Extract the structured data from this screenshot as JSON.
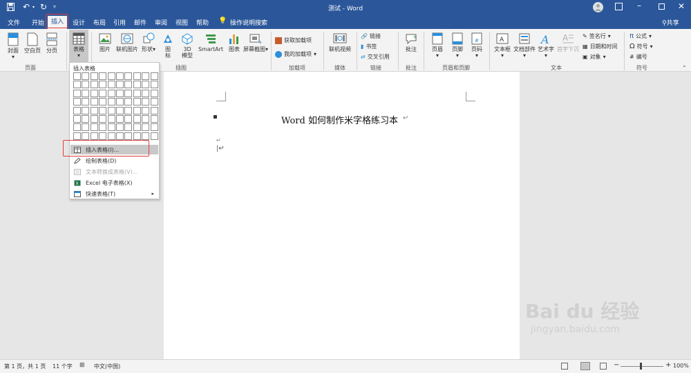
{
  "titlebar": {
    "doc_title": "测试 - Word"
  },
  "tabs": [
    {
      "label": "文件"
    },
    {
      "label": "开始"
    },
    {
      "label": "插入"
    },
    {
      "label": "设计"
    },
    {
      "label": "布局"
    },
    {
      "label": "引用"
    },
    {
      "label": "邮件"
    },
    {
      "label": "审阅"
    },
    {
      "label": "视图"
    },
    {
      "label": "帮助"
    }
  ],
  "tell_me": "操作说明搜索",
  "share": "共享",
  "ribbon": {
    "pages": {
      "cover": "封面",
      "blank": "空白页",
      "break": "分页",
      "group": "页面"
    },
    "tables": {
      "table": "表格"
    },
    "illustrations": {
      "picture": "图片",
      "online_picture": "联机图片",
      "shapes": "形状",
      "icons_line1": "图",
      "icons_line2": "标",
      "model_line1": "3D",
      "model_line2": "模型",
      "smartart": "SmartArt",
      "chart": "图表",
      "screenshot": "屏幕截图",
      "group": "插图"
    },
    "addins": {
      "get": "获取加载项",
      "mine": "我的加载项",
      "group": "加载项"
    },
    "media": {
      "video": "联机视频",
      "group": "媒体"
    },
    "links": {
      "link": "链接",
      "bookmark": "书签",
      "xref": "交叉引用",
      "group": "链接"
    },
    "comments": {
      "comment": "批注",
      "group": "批注"
    },
    "header_footer": {
      "header": "页眉",
      "footer": "页脚",
      "page_number": "页码",
      "group": "页眉和页脚"
    },
    "text": {
      "textbox": "文本框",
      "quickparts": "文档部件",
      "wordart": "艺术字",
      "dropcap": "首字下沉",
      "signature": "签名行",
      "datetime": "日期和时间",
      "object": "对象",
      "group": "文本"
    },
    "symbols": {
      "equation": "公式",
      "symbol": "符号",
      "numbering": "编号",
      "group": "符号"
    }
  },
  "dropdown": {
    "header": "插入表格",
    "items": [
      {
        "label": "插入表格(I)..."
      },
      {
        "label": "绘制表格(D)"
      },
      {
        "label": "文本转换成表格(V)..."
      },
      {
        "label": "Excel 电子表格(X)"
      },
      {
        "label": "快速表格(T)"
      }
    ]
  },
  "document": {
    "title": "Word 如何制作米字格练习本"
  },
  "status": {
    "page": "第 1 页，共 1 页",
    "words": "11 个字",
    "language": "中文(中国)",
    "zoom": "100%"
  },
  "colors": {
    "accent": "#2b579a",
    "highlight_box": "#e03c3c"
  },
  "watermark": {
    "brand": "Bai du 经验",
    "url": "jingyan.baidu.com"
  }
}
